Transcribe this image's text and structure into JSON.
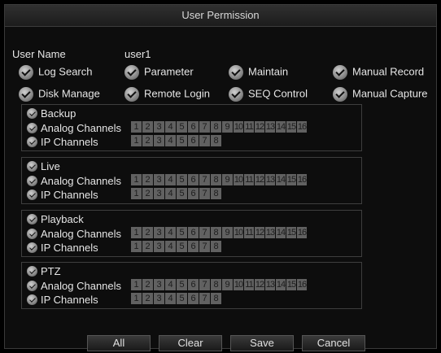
{
  "dialog": {
    "title": "User Permission"
  },
  "user": {
    "label": "User Name",
    "value": "user1"
  },
  "permissions": [
    {
      "label": "Log Search"
    },
    {
      "label": "Parameter"
    },
    {
      "label": "Maintain"
    },
    {
      "label": "Manual Record"
    },
    {
      "label": "Disk Manage"
    },
    {
      "label": "Remote Login"
    },
    {
      "label": "SEQ Control"
    },
    {
      "label": "Manual Capture"
    }
  ],
  "groups": [
    {
      "title": "Backup",
      "analog_label": "Analog Channels",
      "ip_label": "IP Channels"
    },
    {
      "title": "Live",
      "analog_label": "Analog Channels",
      "ip_label": "IP Channels"
    },
    {
      "title": "Playback",
      "analog_label": "Analog Channels",
      "ip_label": "IP Channels"
    },
    {
      "title": "PTZ",
      "analog_label": "Analog Channels",
      "ip_label": "IP Channels"
    }
  ],
  "analog_channels": [
    "1",
    "2",
    "3",
    "4",
    "5",
    "6",
    "7",
    "8",
    "9",
    "10",
    "11",
    "12",
    "13",
    "14",
    "15",
    "16"
  ],
  "ip_channels": [
    "1",
    "2",
    "3",
    "4",
    "5",
    "6",
    "7",
    "8"
  ],
  "buttons": {
    "all": "All",
    "clear": "Clear",
    "save": "Save",
    "cancel": "Cancel"
  },
  "colors": {
    "background": "#000000",
    "panel": "#0d0d0d",
    "channel_cell": "#616161"
  }
}
